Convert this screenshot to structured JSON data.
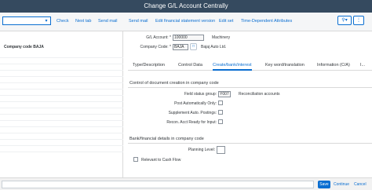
{
  "window": {
    "title": "Change G/L Account Centrally"
  },
  "toolbar": {
    "check": "Check",
    "next_tab": "Next tab",
    "send_mail_1": "Send mail",
    "send_mail_2": "Send mail",
    "edit_fin_stmt": "Edit financial statement version",
    "edit_set": "Edit set",
    "time_dep": "Time-Dependent Attributes"
  },
  "left_pane": {
    "header": "Company code BAJA",
    "row_count": 16
  },
  "header_fields": {
    "gl_account_label": "G/L Account: *",
    "gl_account_value": "100000",
    "gl_account_desc": "Machinery",
    "company_code_label": "Company Code: *",
    "company_code_value": "BAJA",
    "company_code_desc": "Bajaj Auto Ltd."
  },
  "tabs": [
    {
      "label": "Type/Description",
      "active": false
    },
    {
      "label": "Control Data",
      "active": false
    },
    {
      "label": "Create/bank/interest",
      "active": true
    },
    {
      "label": "Key word/translation",
      "active": false
    },
    {
      "label": "Information (C/A)",
      "active": false
    },
    {
      "label": "I...",
      "active": false
    }
  ],
  "doc_creation": {
    "title": "Control of document creation in company code",
    "field_status_label": "Field status group:",
    "field_status_value": "Y007",
    "field_status_desc": "Reconciliation accounts",
    "post_auto_label": "Post Automatically Only:",
    "supp_auto_label": "Supplement Auto. Postings:",
    "recon_label": "Recon. Acct Ready for Input:"
  },
  "bank": {
    "title": "Bank/financial details in company code",
    "planning_label": "Planning Level:",
    "cash_flow_label": "Relevant to Cash Flow"
  },
  "footer": {
    "save": "Save",
    "continue": "Continue",
    "cancel": "Cancel"
  }
}
